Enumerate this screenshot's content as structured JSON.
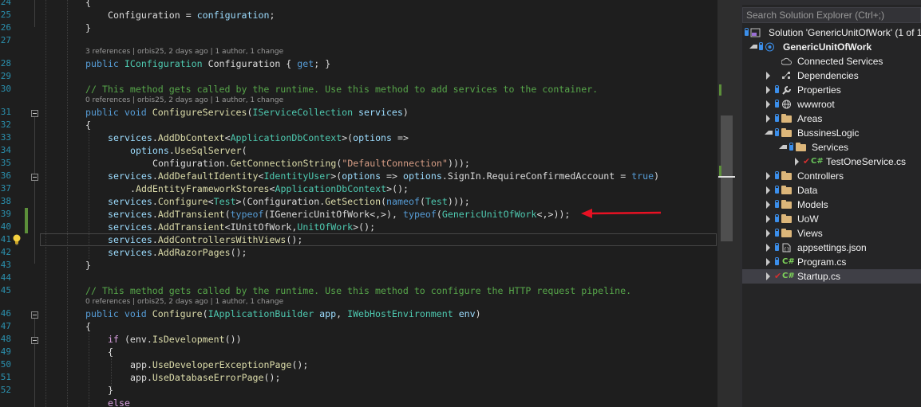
{
  "editor": {
    "line_numbers": [
      "24",
      "25",
      "26",
      "27",
      "28",
      "29",
      "30",
      "31",
      "32",
      "33",
      "34",
      "35",
      "36",
      "37",
      "38",
      "39",
      "40",
      "41",
      "42",
      "43",
      "44",
      "45",
      "46",
      "47",
      "48",
      "49",
      "50",
      "51",
      "52"
    ],
    "codelens": {
      "config_prop": "3 references | orbis25, 2 days ago | 1 author, 1 change",
      "configure_services": "0 references | orbis25, 2 days ago | 1 author, 1 change",
      "configure": "0 references | orbis25, 2 days ago | 1 author, 1 change"
    },
    "lines": {
      "l24": "{",
      "l25_a": "Configuration",
      "l25_b": " = ",
      "l25_c": "configuration",
      "l25_d": ";",
      "l26": "}",
      "l28_kw": "public ",
      "l28_ty": "IConfiguration",
      "l28_a": " Configuration { ",
      "l28_kw2": "get",
      "l28_b": "; }",
      "l30": "// This method gets called by the runtime. Use this method to add services to the container.",
      "l31_kw": "public void ",
      "l31_m": "ConfigureServices",
      "l31_a": "(",
      "l31_ty": "IServiceCollection",
      "l31_p": " services",
      "l31_b": ")",
      "l32": "{",
      "l33_p": "services",
      "l33_a": ".",
      "l33_m": "AddDbContext",
      "l33_b": "<",
      "l33_ty": "ApplicationDbContext",
      "l33_c": ">(",
      "l33_p2": "options",
      "l33_d": " =>",
      "l34_p": "options",
      "l34_a": ".",
      "l34_m": "UseSqlServer",
      "l34_b": "(",
      "l35_a": "Configuration.",
      "l35_m": "GetConnectionString",
      "l35_b": "(",
      "l35_s": "\"DefaultConnection\"",
      "l35_c": ")));",
      "l36_p": "services",
      "l36_a": ".",
      "l36_m": "AddDefaultIdentity",
      "l36_b": "<",
      "l36_ty": "IdentityUser",
      "l36_c": ">(",
      "l36_p2": "options",
      "l36_d": " => ",
      "l36_p3": "options",
      "l36_e": ".SignIn.RequireConfirmedAccount = ",
      "l36_kw": "true",
      "l36_f": ")",
      "l37_a": ".",
      "l37_m": "AddEntityFrameworkStores",
      "l37_b": "<",
      "l37_ty": "ApplicationDbContext",
      "l37_c": ">();",
      "l38_p": "services",
      "l38_a": ".",
      "l38_m": "Configure",
      "l38_b": "<",
      "l38_ty": "Test",
      "l38_c": ">(Configuration.",
      "l38_m2": "GetSection",
      "l38_d": "(",
      "l38_kw": "nameof",
      "l38_e": "(",
      "l38_ty2": "Test",
      "l38_f": ")));",
      "l39_p": "services",
      "l39_a": ".",
      "l39_m": "AddTransient",
      "l39_b": "(",
      "l39_kw": "typeof",
      "l39_c": "(IGenericUnitOfWork<,>), ",
      "l39_kw2": "typeof",
      "l39_d": "(",
      "l39_ty": "GenericUnitOfWork",
      "l39_e": "<,>));",
      "l40_p": "services",
      "l40_a": ".",
      "l40_m": "AddTransient",
      "l40_b": "<IUnitOfWork,",
      "l40_ty": "UnitOfWork",
      "l40_c": ">();",
      "l41_p": "services",
      "l41_a": ".",
      "l41_m": "AddControllersWithViews",
      "l41_b": "();",
      "l42_p": "services",
      "l42_a": ".",
      "l42_m": "AddRazorPages",
      "l42_b": "();",
      "l43": "}",
      "l45": "// This method gets called by the runtime. Use this method to configure the HTTP request pipeline.",
      "l46_kw": "public void ",
      "l46_m": "Configure",
      "l46_a": "(",
      "l46_ty": "IApplicationBuilder",
      "l46_p": " app",
      "l46_b": ", ",
      "l46_ty2": "IWebHostEnvironment",
      "l46_p2": " env",
      "l46_c": ")",
      "l47": "{",
      "l48_kw": "if",
      "l48_a": " (env.",
      "l48_m": "IsDevelopment",
      "l48_b": "())",
      "l49": "{",
      "l50_a": "app.",
      "l50_m": "UseDeveloperExceptionPage",
      "l50_b": "();",
      "l51_a": "app.",
      "l51_m": "UseDatabaseErrorPage",
      "l51_b": "();",
      "l52": "}",
      "l53_kw": "else"
    },
    "split_button": "➕"
  },
  "solution_explorer": {
    "search_placeholder": "Search Solution Explorer (Ctrl+;)",
    "items": [
      {
        "label": "Solution 'GenericUnitOfWork' (1 of 1"
      },
      {
        "label": "GenericUnitOfWork"
      },
      {
        "label": "Connected Services"
      },
      {
        "label": "Dependencies"
      },
      {
        "label": "Properties"
      },
      {
        "label": "wwwroot"
      },
      {
        "label": "Areas"
      },
      {
        "label": "BussinesLogic"
      },
      {
        "label": "Services"
      },
      {
        "label": "TestOneService.cs"
      },
      {
        "label": "Controllers"
      },
      {
        "label": "Data"
      },
      {
        "label": "Models"
      },
      {
        "label": "UoW"
      },
      {
        "label": "Views"
      },
      {
        "label": "appsettings.json"
      },
      {
        "label": "Program.cs"
      },
      {
        "label": "Startup.cs"
      }
    ],
    "cs_badge": "C#"
  },
  "colors": {
    "keyword": "#569cd6",
    "type": "#4ec9b0",
    "comment": "#57a64a",
    "string": "#d69d85",
    "method": "#dcdcaa",
    "param": "#9cdcfe",
    "arrow": "#e81123",
    "change_bar": "#5c8f3a"
  },
  "icons": [
    "lightbulb-icon",
    "fold-icon",
    "red-arrow-annotation",
    "folder-icon",
    "lock-icon",
    "csharp-file-icon",
    "wrench-icon",
    "globe-icon",
    "cloud-icon",
    "dependencies-icon",
    "json-file-icon",
    "solution-icon",
    "project-icon",
    "expand-arrow-icon",
    "split-editor-icon"
  ]
}
